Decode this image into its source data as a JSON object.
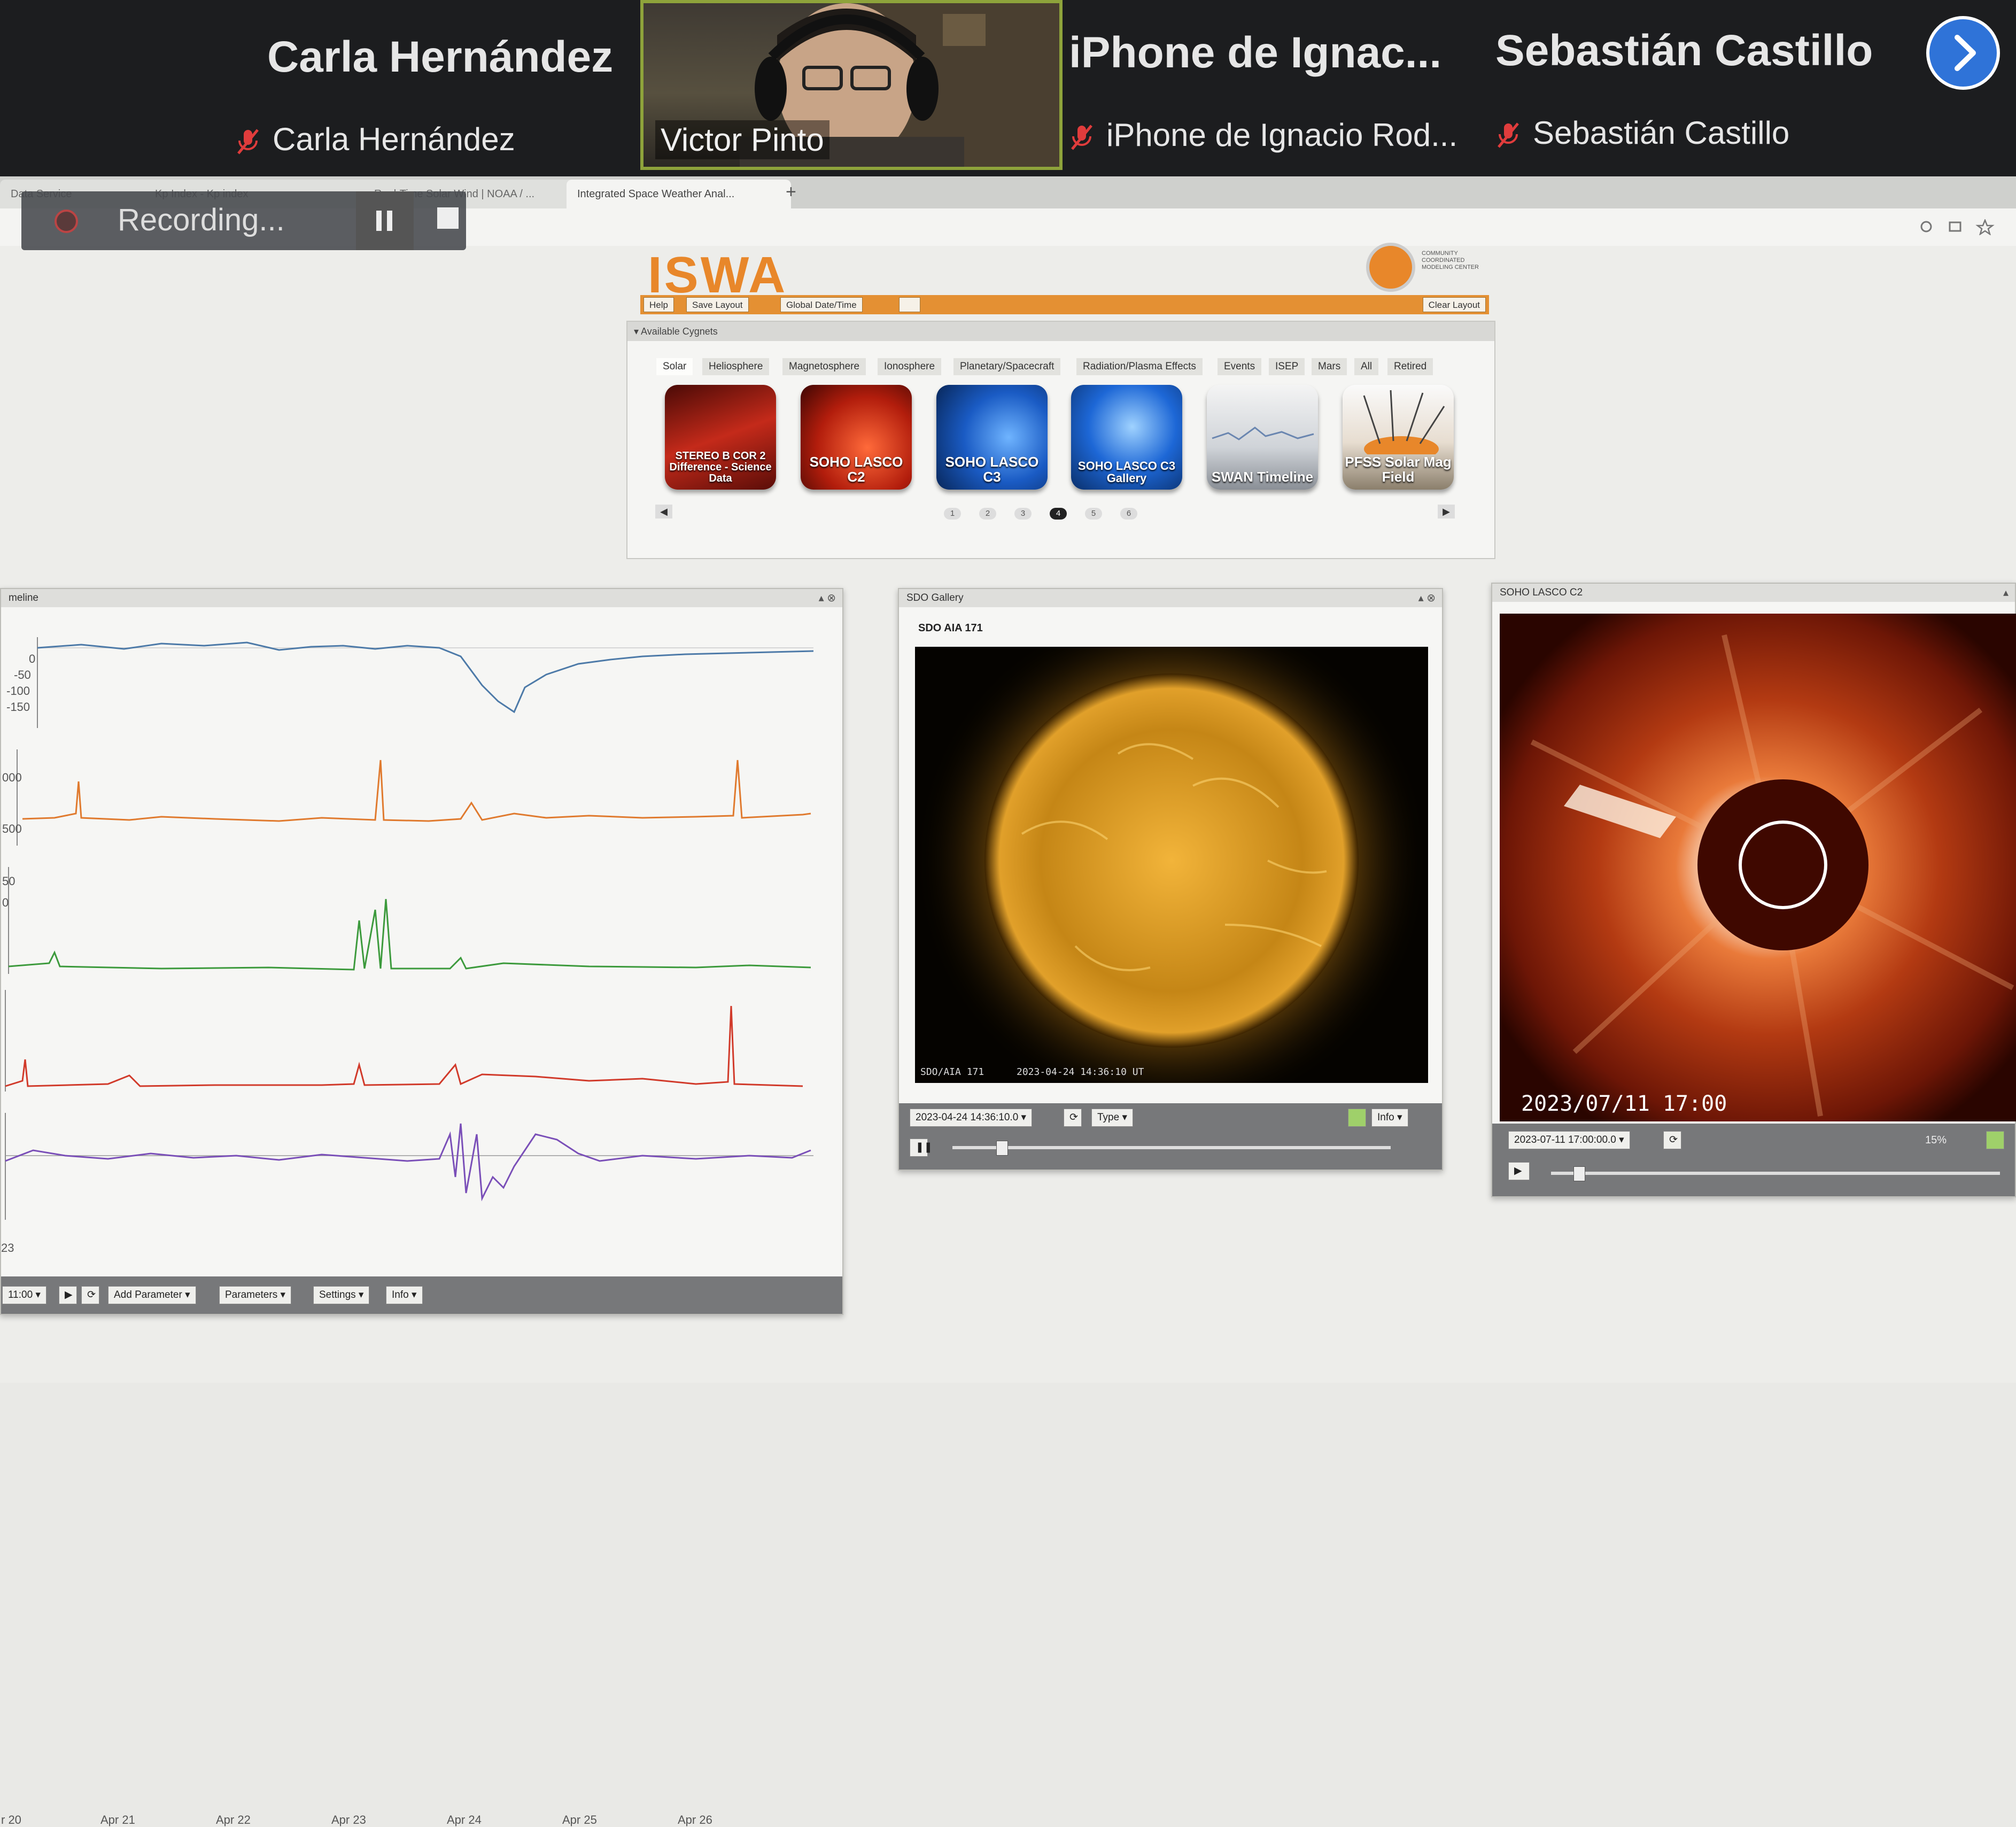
{
  "zoom": {
    "participants": [
      {
        "name": "Carla Hernández",
        "label": "Carla Hernández",
        "muted": true
      },
      {
        "name": "Victor Pinto",
        "label": "Victor Pinto",
        "muted": false,
        "video": true
      },
      {
        "name": "iPhone de Ignac...",
        "label": "iPhone de Ignacio Rod...",
        "muted": true
      },
      {
        "name": "Sebastián Castillo",
        "label": "Sebastián Castillo",
        "muted": true
      }
    ],
    "next_icon": "chevron-right-icon",
    "accent": "#2f73d8"
  },
  "recording": {
    "label": "Recording...",
    "pause_icon": "pause-icon",
    "stop_icon": "stop-icon"
  },
  "browser": {
    "tabs": [
      {
        "label": "Data Service"
      },
      {
        "label": "Kp Index - Kp index"
      },
      {
        "label": "Real-Time Solar Wind | NOAA / ..."
      },
      {
        "label": "Integrated Space Weather Anal..."
      }
    ],
    "new_tab": "+"
  },
  "iswa": {
    "logo": "ISWA",
    "ccmc_text": "COMMUNITY COORDINATED MODELING CENTER",
    "brand_color": "#e8872a",
    "toolbar": {
      "help": "Help",
      "save_layout": "Save Layout",
      "global_datetime": "Global Date/Time",
      "clear_layout": "Clear Layout"
    },
    "cygnets": {
      "header": "Available Cygnets",
      "tabs": [
        "Solar",
        "Heliosphere",
        "Magnetosphere",
        "Ionosphere",
        "Planetary/Spacecraft",
        "Radiation/Plasma Effects",
        "Events",
        "ISEP",
        "Mars",
        "All",
        "Retired"
      ],
      "active_tab": "Solar",
      "items": [
        {
          "label": "STEREO B COR 2 Difference - Science Data"
        },
        {
          "label": "SOHO LASCO C2"
        },
        {
          "label": "SOHO LASCO C3"
        },
        {
          "label": "SOHO LASCO C3 Gallery"
        },
        {
          "label": "SWAN Timeline"
        },
        {
          "label": "PFSS Solar Mag Field"
        }
      ],
      "pages": [
        "1",
        "2",
        "3",
        "4",
        "5",
        "6"
      ],
      "current_page": "4"
    }
  },
  "timeline_window": {
    "title": "meline",
    "y_ticks": [
      "0",
      "-50",
      "-100",
      "-150",
      "000",
      "500",
      "50",
      "0"
    ],
    "x_labels": [
      "r 20",
      "Apr 21",
      "Apr 22",
      "Apr 23",
      "Apr 24",
      "Apr 25",
      "Apr 26"
    ],
    "year_label": "23",
    "footer": {
      "time": "11:00",
      "add_parameter": "Add Parameter",
      "parameters": "Parameters",
      "settings": "Settings",
      "info": "Info"
    }
  },
  "sdo_window": {
    "title": "SDO Gallery",
    "subtitle": "SDO AIA 171",
    "caption_left": "SDO/AIA  171",
    "caption_right": "2023-04-24  14:36:10  UT",
    "datetime": "2023-04-24 14:36:10.0",
    "type": "Type",
    "info": "Info",
    "slider_position": 0.1
  },
  "lasco_window": {
    "title": "SOHO LASCO C2",
    "overlay_time": "2023/07/11  17:00",
    "datetime": "2023-07-11 17:00:00.0",
    "zoom": "15%",
    "slider_position": 0.05
  }
}
